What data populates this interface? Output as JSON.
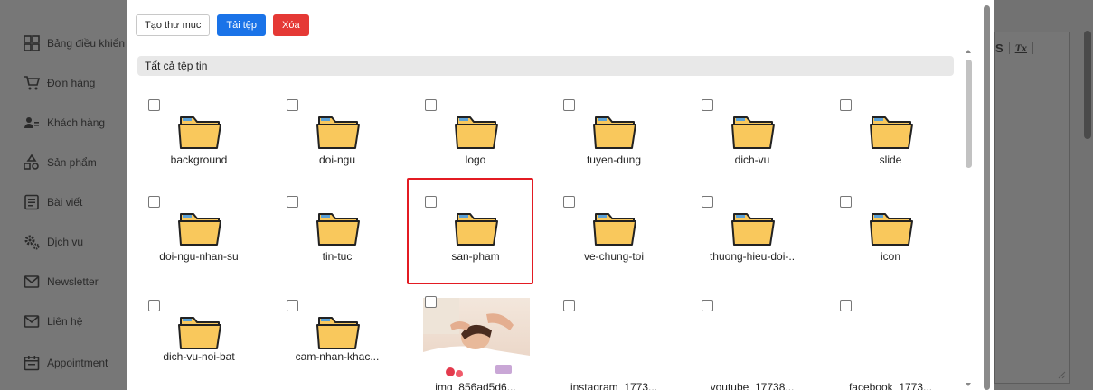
{
  "sidebar": {
    "items": [
      {
        "label": "Bảng điều khiển",
        "icon": "dashboard-icon"
      },
      {
        "label": "Đơn hàng",
        "icon": "cart-icon"
      },
      {
        "label": "Khách hàng",
        "icon": "users-icon"
      },
      {
        "label": "Sản phẩm",
        "icon": "products-icon"
      },
      {
        "label": "Bài viết",
        "icon": "article-icon"
      },
      {
        "label": "Dịch vụ",
        "icon": "services-icon"
      },
      {
        "label": "Newsletter",
        "icon": "mail-icon"
      },
      {
        "label": "Liên hệ",
        "icon": "mail-icon"
      },
      {
        "label": "Appointment",
        "icon": "calendar-icon"
      }
    ]
  },
  "editor": {
    "bold_label": "S",
    "clear_format_label": "Tx"
  },
  "toolbar": {
    "create_folder_label": "Tạo thư mục",
    "upload_label": "Tải tệp",
    "delete_label": "Xóa"
  },
  "breadcrumb": {
    "label": "Tất cả tệp tin"
  },
  "files": [
    {
      "name": "background",
      "type": "folder"
    },
    {
      "name": "doi-ngu",
      "type": "folder"
    },
    {
      "name": "logo",
      "type": "folder"
    },
    {
      "name": "tuyen-dung",
      "type": "folder"
    },
    {
      "name": "dich-vu",
      "type": "folder"
    },
    {
      "name": "slide",
      "type": "folder"
    },
    {
      "name": "doi-ngu-nhan-su",
      "type": "folder"
    },
    {
      "name": "tin-tuc",
      "type": "folder"
    },
    {
      "name": "san-pham",
      "type": "folder",
      "selected": true
    },
    {
      "name": "ve-chung-toi",
      "type": "folder"
    },
    {
      "name": "thuong-hieu-doi-..",
      "type": "folder"
    },
    {
      "name": "icon",
      "type": "folder"
    },
    {
      "name": "dich-vu-noi-bat",
      "type": "folder"
    },
    {
      "name": "cam-nhan-khac...",
      "type": "folder"
    },
    {
      "name": "img_856ad5d6...",
      "type": "image"
    },
    {
      "name": "instagram_1773...",
      "type": "file"
    },
    {
      "name": "youtube_17738...",
      "type": "file"
    },
    {
      "name": "facebook_1773...",
      "type": "file"
    }
  ],
  "colors": {
    "primary": "#1a73e8",
    "danger": "#e53935",
    "folder": "#f9c85c",
    "selection": "#e31b23"
  }
}
